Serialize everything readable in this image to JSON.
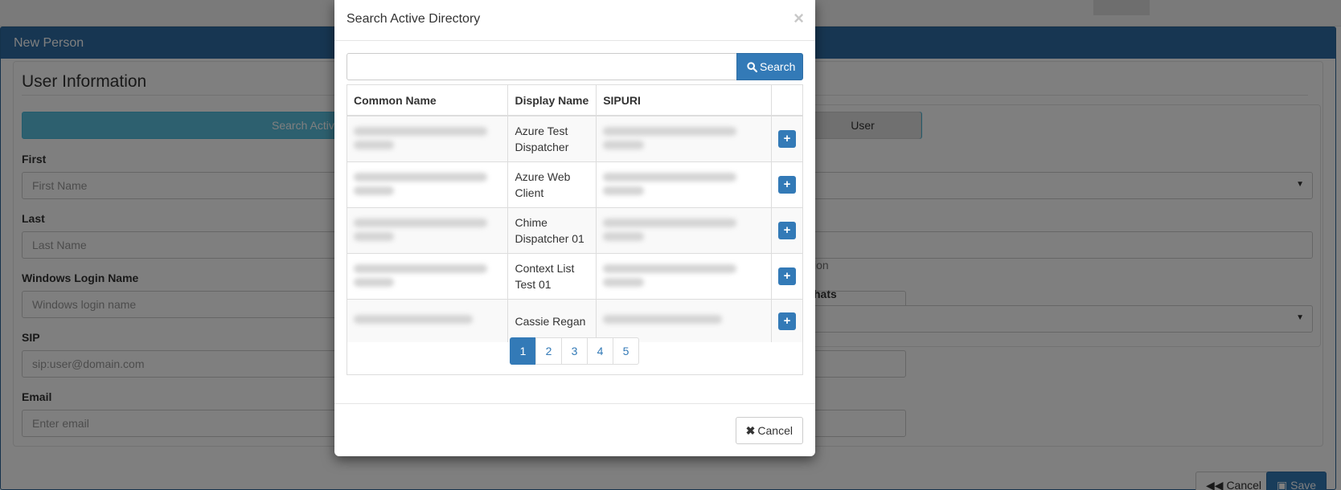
{
  "page": {
    "panel_title": "New Person",
    "legend": "User Information",
    "search_ad_label": "Search Active",
    "user_label": "User",
    "fields": [
      {
        "label": "First",
        "placeholder": "First Name"
      },
      {
        "label": "Last",
        "placeholder": "Last Name"
      },
      {
        "label": "Windows Login Name",
        "placeholder": "Windows login name"
      },
      {
        "label": "SIP",
        "placeholder": "sip:user@domain.com"
      },
      {
        "label": "Email",
        "placeholder": "Enter email"
      }
    ],
    "right_fragment_text": "ion",
    "right_fragment_label": "hats",
    "footer": {
      "cancel_label": "Cancel",
      "save_label": "Save"
    }
  },
  "modal": {
    "title": "Search Active Directory",
    "search_value": "",
    "search_button": "Search",
    "columns": [
      "Common Name",
      "Display Name",
      "SIPURI"
    ],
    "rows": [
      {
        "display_name": "Azure Test Dispatcher"
      },
      {
        "display_name": "Azure Web Client"
      },
      {
        "display_name": "Chime Dispatcher 01"
      },
      {
        "display_name": "Context List Test 01"
      },
      {
        "display_name": "Cassie Regan"
      }
    ],
    "pages": [
      "1",
      "2",
      "3",
      "4",
      "5"
    ],
    "active_page": "1",
    "cancel_button": "Cancel"
  },
  "colors": {
    "primary": "#337ab7",
    "info": "#5bc0de",
    "heading": "#2e6da4"
  }
}
